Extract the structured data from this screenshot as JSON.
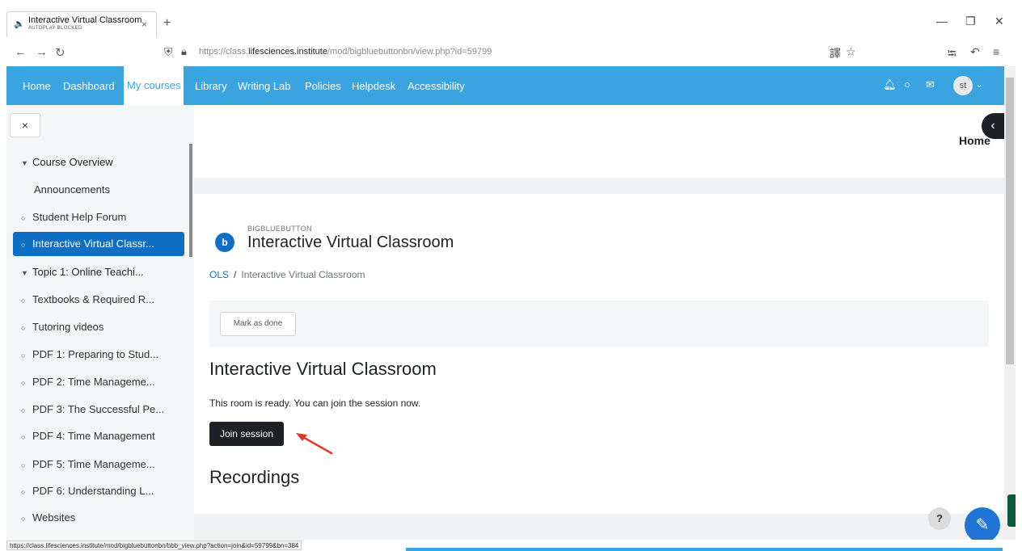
{
  "browser": {
    "tab_title": "Interactive Virtual Classroom",
    "tab_subtitle": "AUTOPLAY BLOCKED",
    "tab_close": "×",
    "new_tab": "+",
    "url_prefix": "https://class.",
    "url_host": "lifesciences.institute",
    "url_path": "/mod/bigbluebuttonbn/view.php?id=59799",
    "status_url": "https://class.lifesciences.institute/mod/bigbluebuttonbn/bbb_view.php?action=join&id=59799&bn=384"
  },
  "sitenav": {
    "items": [
      "Home",
      "Dashboard",
      "My courses",
      "Library",
      "Writing Lab",
      "Policies",
      "Helpdesk",
      "Accessibility"
    ],
    "active": "My courses",
    "avatar_initials": "st"
  },
  "drawer": {
    "close_label": "×",
    "items": [
      {
        "label": "Course Overview",
        "type": "section"
      },
      {
        "label": "Announcements",
        "type": "plain"
      },
      {
        "label": "Student Help Forum",
        "type": "item"
      },
      {
        "label": "Interactive Virtual Classr...",
        "type": "active"
      },
      {
        "label": "Topic 1: Online Teachi...",
        "type": "section"
      },
      {
        "label": "Textbooks & Required R...",
        "type": "item"
      },
      {
        "label": "Tutoring videos",
        "type": "item"
      },
      {
        "label": "PDF 1: Preparing to Stud...",
        "type": "item"
      },
      {
        "label": "PDF 2: Time Manageme...",
        "type": "item"
      },
      {
        "label": "PDF 3: The Successful Pe...",
        "type": "item"
      },
      {
        "label": "PDF 4: Time Management",
        "type": "item"
      },
      {
        "label": "PDF 5: Time Manageme...",
        "type": "item"
      },
      {
        "label": "PDF 6: Understanding L...",
        "type": "item"
      },
      {
        "label": "Websites",
        "type": "item"
      }
    ]
  },
  "main": {
    "home_label": "Home",
    "module_type": "BIGBLUEBUTTON",
    "module_title": "Interactive Virtual Classroom",
    "breadcrumb_root": "OLS",
    "breadcrumb_sep": "/",
    "breadcrumb_current": "Interactive Virtual Classroom",
    "mark_done": "Mark as done",
    "heading": "Interactive Virtual Classroom",
    "room_message": "This room is ready. You can join the session now.",
    "join_label": "Join session",
    "recordings_heading": "Recordings",
    "help_label": "?"
  },
  "colors": {
    "nav_blue": "#3aa4e0",
    "active_blue": "#0f6fc5",
    "join_dark": "#1d2125",
    "arrow_red": "#e0392b"
  }
}
